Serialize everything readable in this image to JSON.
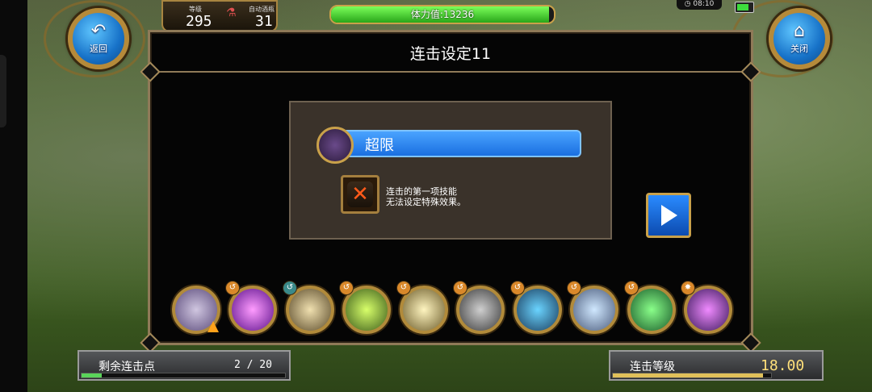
{
  "hud": {
    "back_label": "返回",
    "close_label": "关闭",
    "level_caption": "等级",
    "level_value": "295",
    "auto_potion_caption": "自动酒瓶",
    "auto_potion_value": "31",
    "stamina_label": "体力值:13236",
    "stamina_fraction": 0.98,
    "clock": "08:10",
    "battery_fraction": 0.8
  },
  "dialog": {
    "title": "连击设定11",
    "skill_name": "超限",
    "note_line1": "连击的第一项技能",
    "note_line2": "无法设定特殊效果。"
  },
  "skills": [
    {
      "icon": "triforce-skill-icon",
      "tag": ""
    },
    {
      "icon": "purple-beam-skill-icon",
      "tag": "↺"
    },
    {
      "icon": "cage-skill-icon",
      "tag": "↺"
    },
    {
      "icon": "lightning-figure-skill-icon",
      "tag": "↺"
    },
    {
      "icon": "light-burst-skill-icon",
      "tag": "↺"
    },
    {
      "icon": "book-skill-icon",
      "tag": "↺"
    },
    {
      "icon": "blue-leaf-skill-icon",
      "tag": "↺"
    },
    {
      "icon": "ghost-skill-icon",
      "tag": "↺"
    },
    {
      "icon": "green-figure-skill-icon",
      "tag": "↺"
    },
    {
      "icon": "purple-bolt-skill-icon",
      "tag": "✸"
    }
  ],
  "bottom": {
    "remaining_label": "剩余连击点",
    "remaining_value": "2 / 20",
    "remaining_fraction": 0.1,
    "combo_level_label": "连击等级",
    "combo_level_value": "18.00",
    "combo_level_fraction": 0.95
  },
  "colors": {
    "accent_gold": "#c9a14a",
    "skill_bar_blue": "#1a6fe0",
    "stamina_green": "#2aa61a",
    "combo_value_yellow": "#ffe07a"
  }
}
